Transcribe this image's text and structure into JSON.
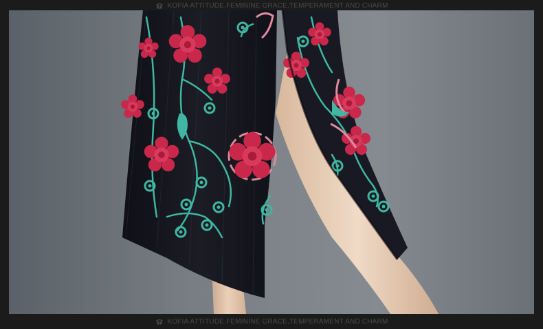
{
  "banner": {
    "top_text": "KOFIA ATTITUDE,FEMININE GRACE,TEMPERAMENT AND CHARM",
    "bottom_text": "KOFIA ATTITUDE,FEMININE GRACE,TEMPERAMENT AND CHARM",
    "icon": "phone-icon"
  },
  "photo": {
    "subject": "embroidered-qipao-skirt-with-side-slit",
    "colors": {
      "background": "#6c7278",
      "fabric": "#15161d",
      "skin": "#e2c3a8",
      "flower_red": "#c9284b",
      "flower_pink": "#e08aa0",
      "vine_teal": "#3fb7a2"
    }
  }
}
